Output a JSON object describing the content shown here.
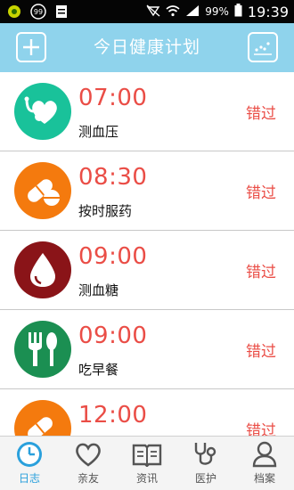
{
  "status_bar": {
    "left_icons": [
      "app-notification-icon",
      "badge-99-icon",
      "document-icon"
    ],
    "badge_text": "99",
    "battery": "99%",
    "time": "19:39"
  },
  "header": {
    "title": "今日健康计划",
    "add_icon": "plus-icon",
    "chart_icon": "scatter-chart-icon",
    "color": "#8fd3ec"
  },
  "schedule": [
    {
      "time": "07:00",
      "label": "测血压",
      "status": "错过",
      "icon": "heart-stethoscope-icon",
      "color": "#19c29a"
    },
    {
      "time": "08:30",
      "label": "按时服药",
      "status": "错过",
      "icon": "pill-icon",
      "color": "#f47a0e"
    },
    {
      "time": "09:00",
      "label": "测血糖",
      "status": "错过",
      "icon": "blood-drop-icon",
      "color": "#8a1418"
    },
    {
      "time": "09:00",
      "label": "吃早餐",
      "status": "错过",
      "icon": "fork-spoon-icon",
      "color": "#1b8f52"
    },
    {
      "time": "12:00",
      "label": "",
      "status": "错过",
      "icon": "pill-icon",
      "color": "#f47a0e"
    }
  ],
  "bottom_nav": [
    {
      "label": "日志",
      "icon": "clock-icon",
      "active": true
    },
    {
      "label": "亲友",
      "icon": "heart-icon",
      "active": false
    },
    {
      "label": "资讯",
      "icon": "book-icon",
      "active": false
    },
    {
      "label": "医护",
      "icon": "stethoscope-icon",
      "active": false
    },
    {
      "label": "档案",
      "icon": "person-icon",
      "active": false
    }
  ],
  "colors": {
    "accent": "#ea4d46",
    "nav_active": "#2aa0dc"
  }
}
